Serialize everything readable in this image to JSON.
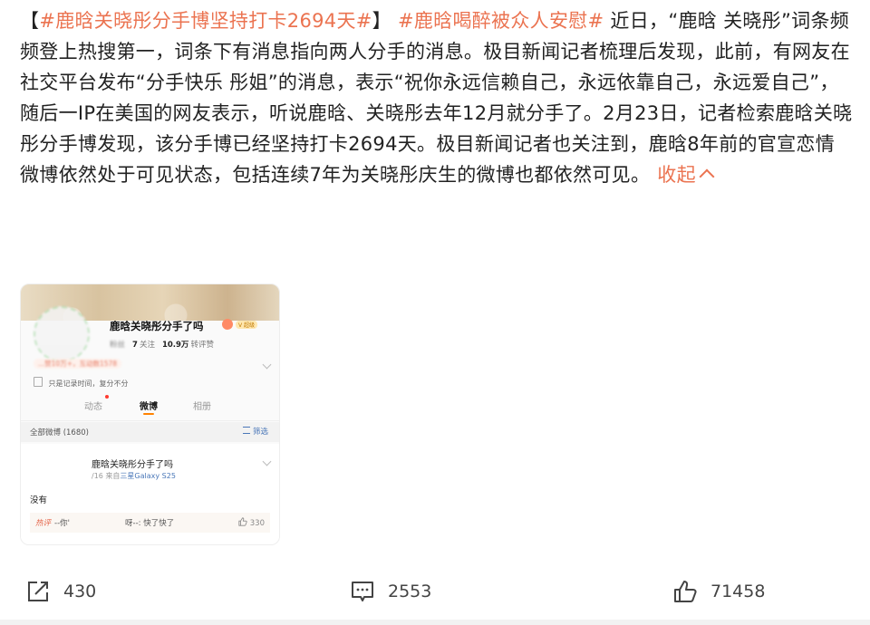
{
  "post": {
    "lead_bracket_open": "【",
    "tag1": "#鹿晗关晓彤分手博坚持打卡2694天#",
    "lead_bracket_close": "】",
    "tag2": "#鹿晗喝醉被众人安慰#",
    "text": " 近日，“鹿晗 关晓彤”词条频频登上热搜第一，词条下有消息指向两人分手的消息。极目新闻记者梳理后发现，此前，有网友在社交平台发布“分手快乐 彤姐”的消息，表示“祝你永远信赖自己，永远依靠自己，永远爱自己”，随后一IP在美国的网友表示，听说鹿晗、关晓彤去年12月就分手了。2月23日，记者检索鹿晗关晓彤分手博发现，该分手博已经坚持打卡2694天。极目新闻记者也关注到，鹿晗8年前的官宣恋情微博依然处于可见状态，包括连续7年为关晓彤庆生的微博也都依然可见。",
    "collapse_label": "收起"
  },
  "card": {
    "profile_name": "鹿晗关晓彤分手了吗",
    "vip_badge": "V 超级",
    "fans_label": "粉丝",
    "follow_count": "7",
    "follow_label": "关注",
    "reposts_count": "10.9万",
    "reposts_label": "转评赞",
    "stat_line": "...赞10万+，互动数1578",
    "bio": "只是记录时间，复分不分",
    "tabs": [
      "动态",
      "微博",
      "相册"
    ],
    "filter_left": "全部微博 (1680)",
    "filter_right": "筛选",
    "post_title": "鹿晗关晓彤分手了吗",
    "post_date": "/16",
    "post_device_prefix": "来自",
    "post_device": "三星Galaxy S25",
    "post_body": "没有",
    "comment_tag": "热评",
    "comment_user": "--你'",
    "comment_text": "呀--: 快了快了",
    "comment_likes": "330"
  },
  "actions": {
    "repost_count": "430",
    "comment_count": "2553",
    "like_count": "71458"
  },
  "colors": {
    "accent": "#eb7350",
    "link": "#4a77b8"
  },
  "icons": {
    "repost": "share-arrow-icon",
    "comment": "comment-bubble-icon",
    "like": "thumbs-up-icon"
  }
}
